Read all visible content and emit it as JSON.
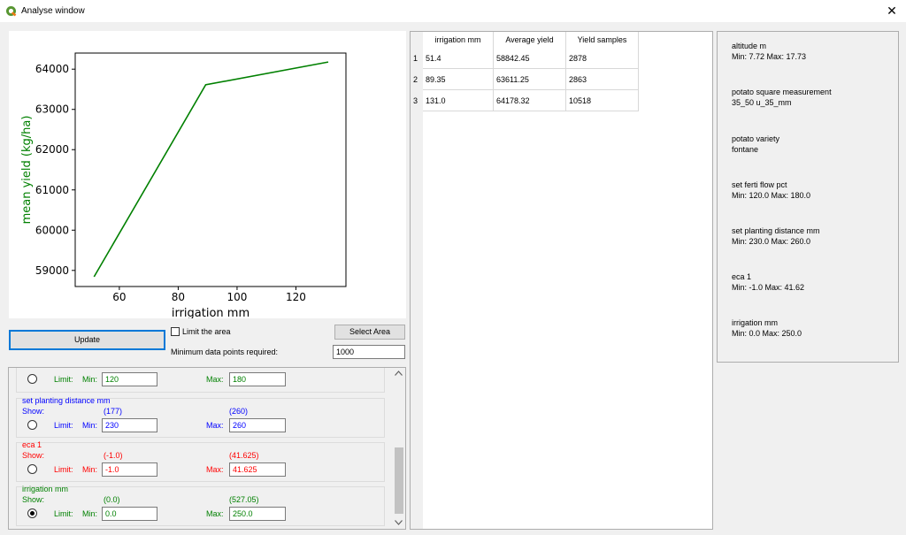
{
  "window": {
    "title": "Analyse window",
    "close_glyph": "✕"
  },
  "chart_data": {
    "type": "line",
    "x": [
      51.4,
      89.35,
      131.0
    ],
    "y": [
      58842.45,
      63611.25,
      64178.32
    ],
    "xlabel": "irrigation mm",
    "ylabel": "mean yield (kg/ha)",
    "xlim": [
      45,
      137
    ],
    "ylim": [
      58600,
      64400
    ],
    "xticks": [
      60,
      80,
      100,
      120
    ],
    "yticks": [
      59000,
      60000,
      61000,
      62000,
      63000,
      64000
    ],
    "line_color": "#008000",
    "grid": false
  },
  "controls": {
    "update_label": "Update",
    "limit_area_label": "Limit the area",
    "select_area_label": "Select Area",
    "min_points_label": "Minimum data points required:",
    "min_points_value": "1000"
  },
  "filters": {
    "show_label": "Show:",
    "limit_label": "Limit:",
    "min_label": "Min:",
    "max_label": "Max:",
    "ferti": {
      "min_value": "120",
      "max_value": "180",
      "color": "#008000"
    },
    "planting": {
      "name": "set planting distance  mm",
      "show_min": "(177)",
      "show_max": "(260)",
      "min_value": "230",
      "max_value": "260",
      "color": "#0000ff"
    },
    "eca": {
      "name": "eca 1",
      "show_min": "(-1.0)",
      "show_max": "(41.625)",
      "min_value": "-1.0",
      "max_value": "41.625",
      "color": "#ff0000"
    },
    "irrigation": {
      "name": "irrigation mm",
      "show_min": "(0.0)",
      "show_max": "(527.05)",
      "min_value": "0.0",
      "max_value": "250.0",
      "color": "#008000",
      "selected": true
    }
  },
  "table": {
    "headers": [
      "irrigation mm",
      "Average yield",
      "Yield samples"
    ],
    "row_numbers": [
      "1",
      "2",
      "3"
    ],
    "rows": [
      [
        "51.4",
        "58842.45",
        "2878"
      ],
      [
        "89.35",
        "63611.25",
        "2863"
      ],
      [
        "131.0",
        "64178.32",
        "10518"
      ]
    ]
  },
  "info": [
    {
      "title": "altitude  m",
      "detail": "Min: 7.72 Max: 17.73"
    },
    {
      "title": "potato square measurement",
      "detail": "35_50 u_35_mm"
    },
    {
      "title": "potato variety",
      "detail": "fontane"
    },
    {
      "title": "set ferti flow pct",
      "detail": "Min: 120.0 Max: 180.0"
    },
    {
      "title": "set planting distance  mm",
      "detail": "Min: 230.0 Max: 260.0"
    },
    {
      "title": "eca 1",
      "detail": "Min: -1.0 Max: 41.62"
    },
    {
      "title": "irrigation mm",
      "detail": "Min: 0.0 Max: 250.0"
    }
  ]
}
